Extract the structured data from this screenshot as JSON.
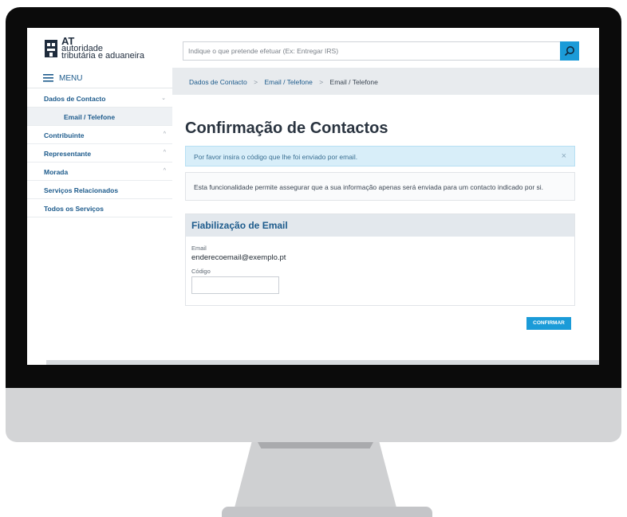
{
  "header": {
    "logo_at": "AT",
    "logo_line1": "autoridade",
    "logo_line2": "tributária e aduaneira",
    "search_placeholder": "Indique o que pretende efetuar (Ex: Entregar IRS)"
  },
  "sidebar": {
    "menu_label": "MENU",
    "items": [
      {
        "label": "Dados de Contacto",
        "chevron": "⌄"
      },
      {
        "label": "Email / Telefone",
        "chevron": ""
      },
      {
        "label": "Contribuinte",
        "chevron": "^"
      },
      {
        "label": "Representante",
        "chevron": "^"
      },
      {
        "label": "Morada",
        "chevron": "^"
      },
      {
        "label": "Serviços Relacionados",
        "chevron": ""
      },
      {
        "label": "Todos os Serviços",
        "chevron": ""
      }
    ]
  },
  "breadcrumb": {
    "items": [
      "Dados de Contacto",
      "Email / Telefone",
      "Email / Telefone"
    ],
    "separator": ">"
  },
  "main": {
    "title": "Confirmação de Contactos",
    "alert_text": "Por favor insira o código que lhe foi enviado por email.",
    "alert_close": "×",
    "info_text": "Esta funcionalidade permite assegurar que a sua informação apenas será enviada para um contacto indicado por si.",
    "card_title": "Fiabilização de Email",
    "email_label": "Email",
    "email_value": "enderecoemail@exemplo.pt",
    "code_label": "Código",
    "code_value": "",
    "confirm_label": "CONFIRMAR"
  },
  "colors": {
    "accent": "#1b9bd8",
    "link": "#1d5b8c",
    "alert_bg": "#d8eef9"
  }
}
